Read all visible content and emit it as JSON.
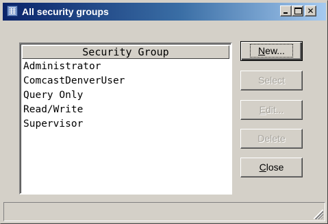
{
  "window": {
    "title": "All security groups",
    "app_icon": "grid-icon",
    "controls": {
      "minimize_icon": "minimize-icon",
      "maximize_icon": "maximize-icon",
      "close_glyph": "✕"
    }
  },
  "list": {
    "header": "Security Group",
    "items": [
      "Administrator",
      "ComcastDenverUser",
      "Query Only",
      "Read/Write",
      "Supervisor"
    ]
  },
  "buttons": {
    "new": {
      "label": "New...",
      "enabled": true,
      "default": true
    },
    "select": {
      "label": "Select",
      "enabled": false
    },
    "edit": {
      "label": "Edit...",
      "enabled": false
    },
    "delete": {
      "label": "Delete",
      "enabled": false
    },
    "close": {
      "label": "Close",
      "enabled": true
    }
  },
  "status": {
    "text": ""
  }
}
